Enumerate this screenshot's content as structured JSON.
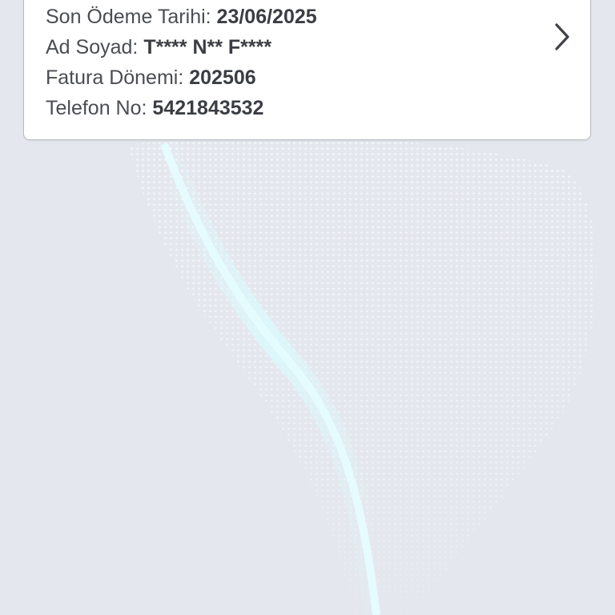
{
  "bill": {
    "due_date_label": "Son Ödeme Tarihi: ",
    "due_date_value": "23/06/2025",
    "name_label": "Ad Soyad: ",
    "name_value": "T**** N** F****",
    "period_label": "Fatura Dönemi: ",
    "period_value": "202506",
    "phone_label": "Telefon No: ",
    "phone_value": "5421843532",
    "detail_icon": "chevron-right-icon"
  },
  "colors": {
    "background": "#e4e8ee",
    "card": "#ffffff",
    "card_border": "#b9bdc3",
    "label_text": "#4a4d52",
    "value_text": "#3a3d42",
    "wave_accent": "#d9fbff"
  }
}
